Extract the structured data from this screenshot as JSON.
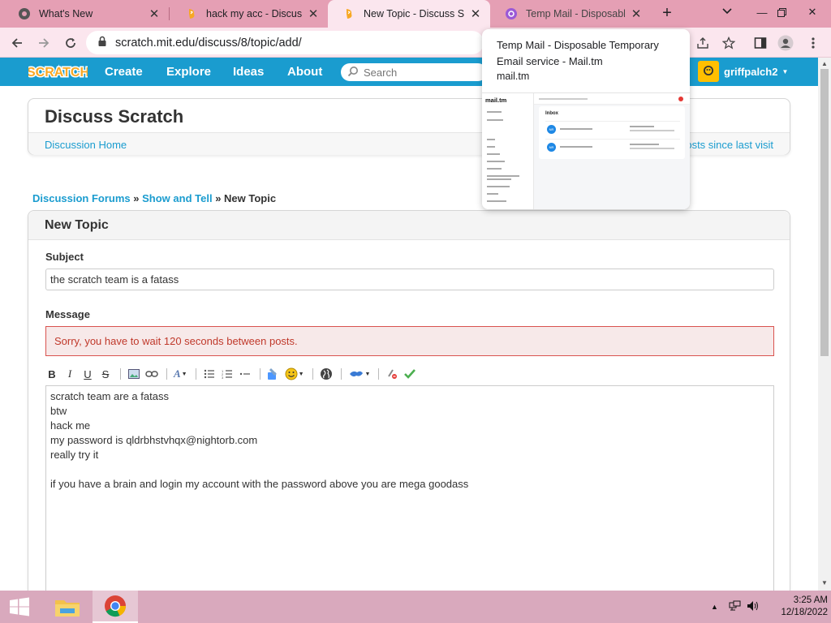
{
  "browser": {
    "tabs": [
      {
        "title": "What's New",
        "icon": "chrome-icon"
      },
      {
        "title": "hack my acc - Discuss Sc",
        "icon": "scratch-icon"
      },
      {
        "title": "New Topic - Discuss Scra",
        "icon": "scratch-icon",
        "active": true
      },
      {
        "title": "Temp Mail - Disposable T",
        "icon": "mailtm-icon"
      }
    ],
    "url": "scratch.mit.edu/discuss/8/topic/add/"
  },
  "hover_card": {
    "title": "Temp Mail - Disposable Temporary Email service - Mail.tm",
    "domain": "mail.tm",
    "preview": {
      "logo": "mail.tm",
      "heading": "Inbox",
      "avatar1": "NR",
      "avatar2": "NR"
    }
  },
  "scratch_nav": {
    "logo": "SCRATCH",
    "links": [
      "Create",
      "Explore",
      "Ideas",
      "About"
    ],
    "search_placeholder": "Search",
    "username": "griffpalch2"
  },
  "discuss": {
    "title": "Discuss Scratch",
    "home_link": "Discussion Home",
    "since_link": "osts since last visit"
  },
  "breadcrumb": {
    "forums": "Discussion Forums",
    "sep": "»",
    "category": "Show and Tell",
    "current": "New Topic"
  },
  "form": {
    "heading": "New Topic",
    "subject_label": "Subject",
    "subject_value": "the scratch team is a fatass",
    "message_label": "Message",
    "error": "Sorry, you have to wait 120 seconds between posts.",
    "message_value": "scratch team are a fatass\nbtw\nhack me\nmy password is qldrbhstvhqx@nightorb.com\nreally try it\n\nif you have a brain and login my account with the password above you are mega goodass"
  },
  "taskbar": {
    "time": "3:25 AM",
    "date": "12/18/2022"
  },
  "colors": {
    "scratch_blue": "#1a9ccf",
    "tab_strip": "#e59fb4",
    "error_red": "#d9534f"
  }
}
